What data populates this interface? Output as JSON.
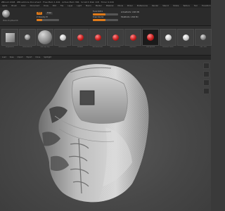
{
  "window": {
    "title": "ZBrush 2018 · ZBrushCore Document · Free Mem 1.402 · Active Mem 384 · Scratch Disk 118 · Timer 0.016"
  },
  "menu": {
    "items": [
      "Alpha",
      "Brush",
      "Color",
      "Document",
      "Draw",
      "Edit",
      "File",
      "Layer",
      "Light",
      "Macro",
      "Marker",
      "Material",
      "Movie",
      "Picker",
      "Preferences",
      "Render",
      "Stencil",
      "Stroke",
      "Texture",
      "Tool",
      "Transform",
      "Zplugin",
      "Zscript"
    ]
  },
  "toolbar": {
    "edit_label": "Edit",
    "draw_label": "Draw",
    "z_intensity_label": "Z Intensity 25",
    "draw_size_label": "Draw Size 64",
    "focal_shift_label": "Focal Shift 0",
    "rgb_intensity_label": "Rgb Intensity 100",
    "active_points": "ActivePoints: 1.822 Mil",
    "total_points": "TotalPoints: 1.822 Mil",
    "hint": "Make PolyMesh3D",
    "z_intensity": 0.25,
    "draw_size": 0.5
  },
  "thumbnails": [
    {
      "label": "PolyMesh3D",
      "type": "square"
    },
    {
      "label": "BasicMaterial",
      "type": "gray-small"
    },
    {
      "label": "MatCap Gray",
      "type": "gray-large"
    },
    {
      "label": "SkinShade4",
      "type": "white"
    },
    {
      "label": "RedWax",
      "type": "red"
    },
    {
      "label": "BasicMaterial2",
      "type": "red"
    },
    {
      "label": "BasicMaterial3",
      "type": "red"
    },
    {
      "label": "ToyPlastic",
      "type": "red"
    },
    {
      "label": "MatCap Red",
      "type": "red-dark"
    },
    {
      "label": "BasicMat White",
      "type": "white"
    },
    {
      "label": "Sketch",
      "type": "white"
    },
    {
      "label": "Flat Color",
      "type": "gray-small"
    }
  ],
  "subbar": {
    "items": [
      "Load",
      "Save",
      "Import",
      "Export",
      "Clone",
      "Spotlight"
    ]
  }
}
